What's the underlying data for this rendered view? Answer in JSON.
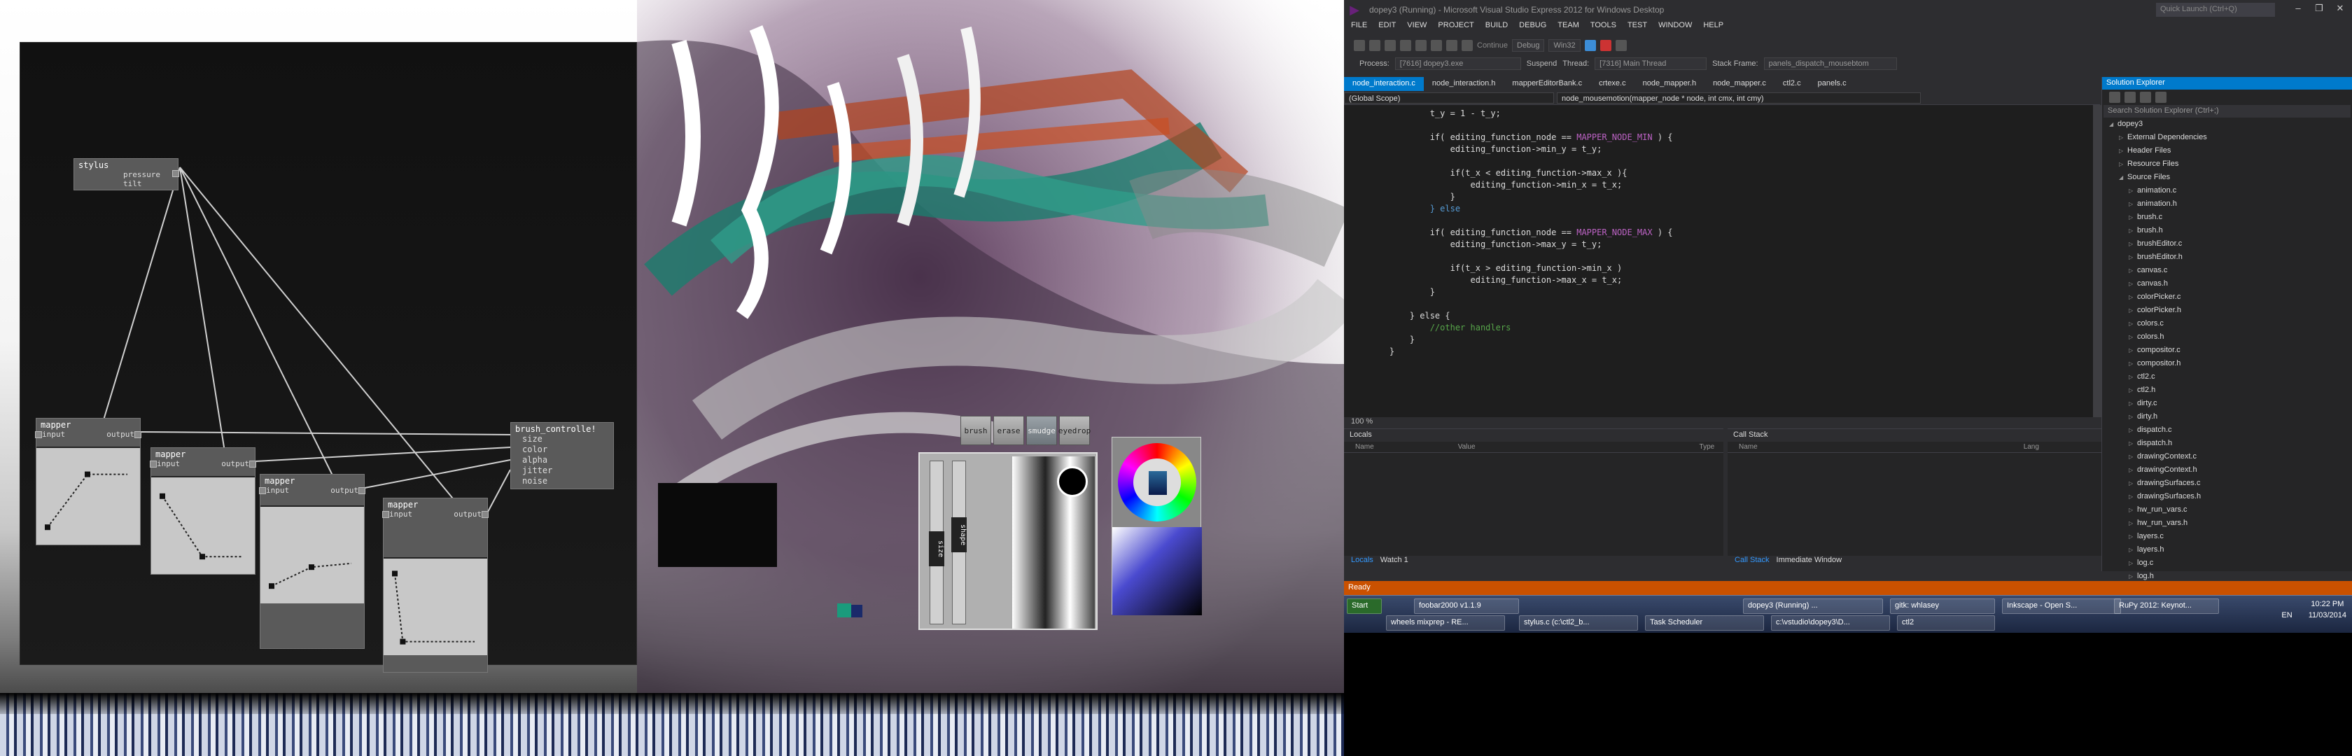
{
  "nodes": {
    "stylus": {
      "title": "stylus",
      "ports": [
        "pressure",
        "tilt"
      ]
    },
    "mapper_label": "mapper",
    "mapper_ports": {
      "input": "input",
      "output": "output"
    },
    "brush_controller": {
      "title": "brush_controlle!",
      "ports": [
        "size",
        "color",
        "alpha",
        "jitter",
        "noise"
      ]
    },
    "mapper_curves": [
      {
        "points": [
          [
            0,
            0.1
          ],
          [
            0.5,
            0.8
          ],
          [
            1,
            0.8
          ]
        ]
      },
      {
        "points": [
          [
            0,
            0.9
          ],
          [
            0.5,
            0.1
          ],
          [
            1,
            0.1
          ]
        ]
      },
      {
        "points": [
          [
            0,
            0.1
          ],
          [
            0.5,
            0.35
          ],
          [
            1,
            0.4
          ]
        ]
      },
      {
        "points": [
          [
            0,
            0.95
          ],
          [
            0.1,
            0.05
          ],
          [
            1,
            0.05
          ]
        ]
      }
    ]
  },
  "tools": {
    "buttons": [
      "brush",
      "erase",
      "smudge",
      "eyedrop"
    ],
    "active": "smudge",
    "slider_labels": [
      "size",
      "shape"
    ]
  },
  "ide": {
    "title": "dopey3 (Running) - Microsoft Visual Studio Express 2012 for Windows Desktop",
    "quick_launch": "Quick Launch (Ctrl+Q)",
    "menu": [
      "FILE",
      "EDIT",
      "VIEW",
      "PROJECT",
      "BUILD",
      "DEBUG",
      "TEAM",
      "TOOLS",
      "TEST",
      "WINDOW",
      "HELP"
    ],
    "continue_label": "Continue",
    "config": "Debug",
    "platform": "Win32",
    "process_label": "Process:",
    "process": "[7616] dopey3.exe",
    "suspend_label": "Suspend",
    "thread_label": "Thread:",
    "thread": "[7316] Main Thread",
    "stack_frame_label": "Stack Frame:",
    "stack_frame": "panels_dispatch_mousebtom",
    "tabs": [
      "node_interaction.c",
      "node_interaction.h",
      "mapperEditorBank.c",
      "crtexe.c",
      "node_mapper.h",
      "node_mapper.c",
      "ctl2.c",
      "panels.c"
    ],
    "scope": "(Global Scope)",
    "function": "node_mousemotion(mapper_node * node, int cmx, int cmy)",
    "code_lines": [
      {
        "indent": 2,
        "text": "t_y = 1 - t_y;",
        "k": ""
      },
      {
        "indent": 0,
        "text": "",
        "k": ""
      },
      {
        "indent": 2,
        "text": "if( editing_function_node == ",
        "mac": "MAPPER_NODE_MIN",
        "tail": " ) {"
      },
      {
        "indent": 3,
        "text": "editing_function->min_y = t_y;",
        "k": ""
      },
      {
        "indent": 0,
        "text": "",
        "k": ""
      },
      {
        "indent": 3,
        "text": "if(t_x < editing_function->max_x ){",
        "k": ""
      },
      {
        "indent": 4,
        "text": "editing_function->min_x = t_x;",
        "k": ""
      },
      {
        "indent": 3,
        "text": "}",
        "k": ""
      },
      {
        "indent": 2,
        "text": "} else",
        "k": "kw"
      },
      {
        "indent": 0,
        "text": "",
        "k": ""
      },
      {
        "indent": 2,
        "text": "if( editing_function_node == ",
        "mac": "MAPPER_NODE_MAX",
        "tail": " ) {"
      },
      {
        "indent": 3,
        "text": "editing_function->max_y = t_y;",
        "k": ""
      },
      {
        "indent": 0,
        "text": "",
        "k": ""
      },
      {
        "indent": 3,
        "text": "if(t_x > editing_function->min_x )",
        "k": ""
      },
      {
        "indent": 4,
        "text": "editing_function->max_x = t_x;",
        "k": ""
      },
      {
        "indent": 2,
        "text": "}",
        "k": ""
      },
      {
        "indent": 0,
        "text": "",
        "k": ""
      },
      {
        "indent": 1,
        "text": "} else {",
        "k": ""
      },
      {
        "indent": 2,
        "text": "//other handlers",
        "k": "cm"
      },
      {
        "indent": 1,
        "text": "}",
        "k": ""
      },
      {
        "indent": 0,
        "text": "}",
        "k": ""
      }
    ],
    "zoom": "100 %",
    "locals": {
      "title": "Locals",
      "cols": [
        "Name",
        "Value",
        "Type"
      ],
      "tabs": [
        "Locals",
        "Watch 1"
      ]
    },
    "callstack": {
      "title": "Call Stack",
      "cols": [
        "Name",
        "Lang"
      ],
      "tabs": [
        "Call Stack",
        "Immediate Window"
      ]
    },
    "solution": {
      "title": "Solution Explorer",
      "search": "Search Solution Explorer (Ctrl+;)",
      "project": "dopey3",
      "folders": [
        "External Dependencies",
        "Header Files",
        "Resource Files",
        "Source Files"
      ],
      "files": [
        "animation.c",
        "animation.h",
        "brush.c",
        "brush.h",
        "brushEditor.c",
        "brushEditor.h",
        "canvas.c",
        "canvas.h",
        "colorPicker.c",
        "colorPicker.h",
        "colors.c",
        "colors.h",
        "compositor.c",
        "compositor.h",
        "ctl2.c",
        "ctl2.h",
        "dirty.c",
        "dirty.h",
        "dispatch.c",
        "dispatch.h",
        "drawingContext.c",
        "drawingContext.h",
        "drawingSurfaces.c",
        "drawingSurfaces.h",
        "hw_run_vars.c",
        "hw_run_vars.h",
        "layers.c",
        "layers.h",
        "log.c",
        "log.h"
      ]
    },
    "status": "Ready",
    "taskbar": {
      "start": "Start",
      "row1": [
        "foobar2000 v1.1.9",
        "dopey3 (Running) ...",
        "gitk: whlasey",
        "Inkscape - Open S...",
        "RuPy 2012: Keynot..."
      ],
      "row2": [
        "wheels mixprep - RE...",
        "stylus.c (c:\\ctl2_b...",
        "Task Scheduler",
        "c:\\vstudio\\dopey3\\D...",
        "ctl2"
      ],
      "lang": "EN",
      "time": "10:22 PM",
      "date": "11/03/2014"
    }
  }
}
